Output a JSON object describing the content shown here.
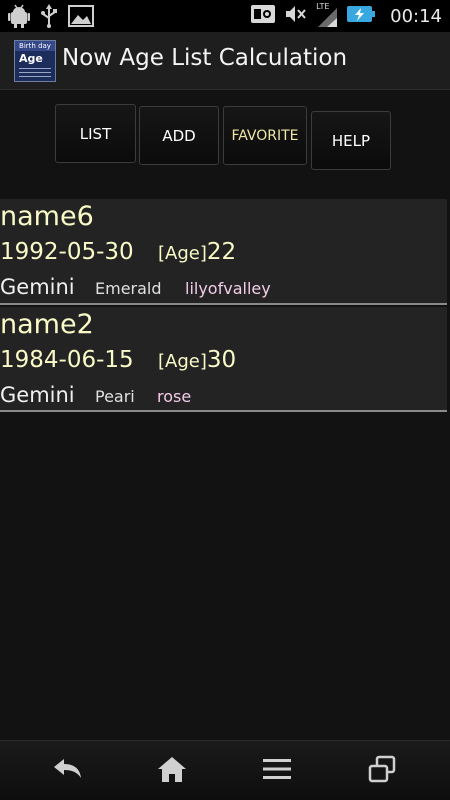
{
  "status_bar": {
    "time": "00:14",
    "network_label": "LTE",
    "icons": [
      "android-debug-icon",
      "usb-icon",
      "image-icon",
      "voicemail-icon",
      "mute-icon",
      "signal-icon",
      "battery-charging-icon"
    ]
  },
  "app": {
    "title": "Now Age List Calculation",
    "icon_text_top": "Birth day",
    "icon_text_age": "Age"
  },
  "buttons": {
    "list": "LIST",
    "add": "ADD",
    "favorite": "FAVORITE",
    "help": "HELP"
  },
  "age_label": "[Age]",
  "entries": [
    {
      "name": "name6",
      "birthdate": "1992-05-30",
      "age": "22",
      "zodiac": "Gemini",
      "birthstone": "Emerald",
      "flower": "lilyofvalley"
    },
    {
      "name": "name2",
      "birthdate": "1984-06-15",
      "age": "30",
      "zodiac": "Gemini",
      "birthstone": "Peari",
      "flower": "rose"
    }
  ],
  "nav": [
    "back-icon",
    "home-icon",
    "menu-icon",
    "recent-apps-icon"
  ],
  "colors": {
    "highlight_text": "#fafac8",
    "flower_text": "#f3cce8",
    "background": "#121212"
  }
}
